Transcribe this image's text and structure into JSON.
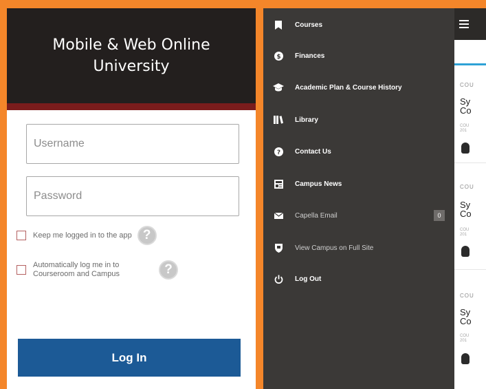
{
  "login": {
    "title": "Mobile & Web Online University",
    "username_placeholder": "Username",
    "password_placeholder": "Password",
    "keep_logged_in_label": "Keep me logged in to the app",
    "auto_login_label": "Automatically log me in to Courseroom and Campus",
    "login_button": "Log In"
  },
  "drawer": {
    "items": [
      {
        "label": "Courses",
        "icon": "bookmark-icon"
      },
      {
        "label": "Finances",
        "icon": "dollar-icon"
      },
      {
        "label": "Academic Plan & Course History",
        "icon": "graduation-cap-icon"
      },
      {
        "label": "Library",
        "icon": "library-icon"
      },
      {
        "label": "Contact Us",
        "icon": "question-icon"
      },
      {
        "label": "Campus News",
        "icon": "newspaper-icon"
      },
      {
        "label": "Capella Email",
        "icon": "envelope-icon",
        "badge": "0"
      },
      {
        "label": "View Campus on Full Site",
        "icon": "shield-icon"
      },
      {
        "label": "Log Out",
        "icon": "power-icon"
      }
    ]
  },
  "main_peek": {
    "cards": [
      {
        "label": "COU",
        "title_line1": "Sy",
        "title_line2": "Co",
        "meta1": "COU",
        "meta2": "201"
      },
      {
        "label": "COU",
        "title_line1": "Sy",
        "title_line2": "Co",
        "meta1": "COU",
        "meta2": "201"
      },
      {
        "label": "COU",
        "title_line1": "Sy",
        "title_line2": "Co",
        "meta1": "COU",
        "meta2": "201"
      }
    ]
  },
  "colors": {
    "background": "#f4862a",
    "login_header": "#231f1e",
    "accent_bar": "#7a1c1c",
    "login_button": "#1c5a96",
    "drawer": "#3b3937",
    "tab_underline": "#2ea2d6"
  }
}
